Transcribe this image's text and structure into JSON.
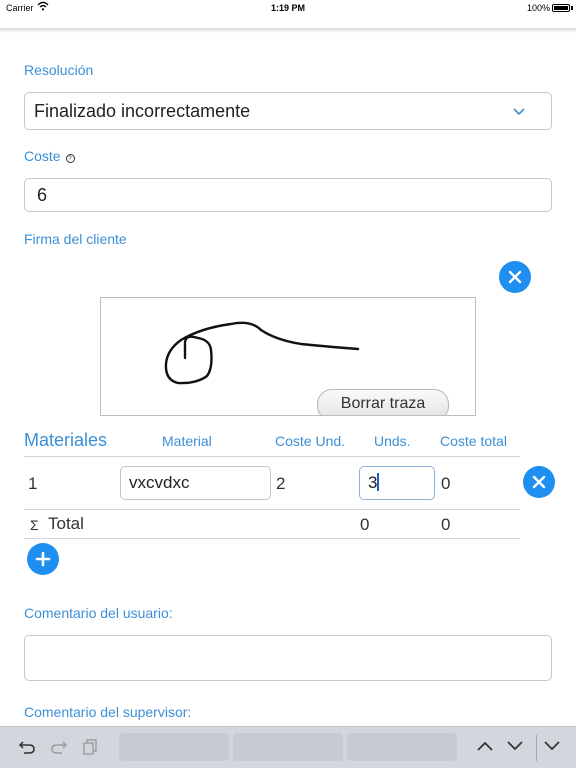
{
  "status_bar": {
    "carrier": "Carrier",
    "time": "1:19 PM",
    "battery": "100%"
  },
  "form": {
    "resolution_label": "Resolución",
    "resolution_value": "Finalizado incorrectamente",
    "cost_label": "Coste",
    "cost_value": "6",
    "signature_label": "Firma del cliente",
    "clear_signature_label": "Borrar traza"
  },
  "materials": {
    "title": "Materiales",
    "columns": [
      "Material",
      "Coste Und.",
      "Unds.",
      "Coste total"
    ],
    "rows": [
      {
        "index": "1",
        "material": "vxcvdxc",
        "unit_cost": "2",
        "units": "3",
        "total_cost": "0"
      }
    ],
    "total_symbol": "Σ",
    "total_label": "Total",
    "total_units": "0",
    "total_cost": "0"
  },
  "comments": {
    "user_label": "Comentario del usuario:",
    "user_value": "",
    "supervisor_label": "Comentario del supervisor:"
  },
  "colors": {
    "accent": "#3b8fd6",
    "button": "#1e8ff0"
  },
  "icons": [
    "wifi-icon",
    "chevron-down-icon",
    "help-icon",
    "close-icon",
    "add-icon",
    "undo-icon",
    "redo-icon",
    "paste-icon",
    "chevron-up-icon",
    "keyboard-dismiss-icon"
  ]
}
